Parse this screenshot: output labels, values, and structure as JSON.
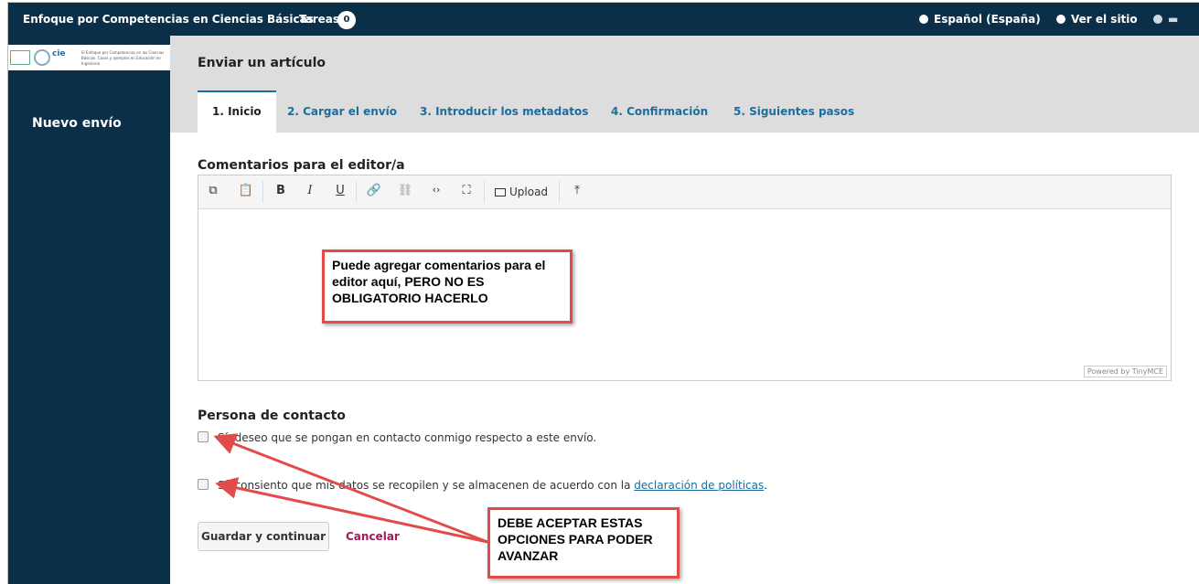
{
  "topbar": {
    "site_title": "Enfoque por Competencias en Ciencias Básicas",
    "tasks_label": "Tareas",
    "tasks_count": "0",
    "language": "Español (España)",
    "view_site": "Ver el sitio"
  },
  "sidebar": {
    "logo_text": "El Enfoque por Competencias en las Ciencias Básicas. Casos y ejemplos en Educación en Ingeniería",
    "new_submission": "Nuevo envío"
  },
  "header": {
    "title": "Enviar un artículo",
    "tabs": [
      {
        "label": "1. Inicio",
        "active": true
      },
      {
        "label": "2. Cargar el envío"
      },
      {
        "label": "3. Introducir los metadatos"
      },
      {
        "label": "4. Confirmación"
      },
      {
        "label": "5. Siguientes pasos"
      }
    ]
  },
  "comments": {
    "title": "Comentarios para el editor/a",
    "upload_label": "Upload",
    "powered_by": "Powered by TinyMCE"
  },
  "contact": {
    "title": "Persona de contacto",
    "option1": "Sí, deseo que se pongan en contacto conmigo respecto a este envío.",
    "option2_prefix": "Sí, consiento que mis datos se recopilen y se almacenen de acuerdo con la ",
    "option2_link": "declaración de políticas",
    "option2_suffix": "."
  },
  "actions": {
    "save": "Guardar y continuar",
    "cancel": "Cancelar"
  },
  "annotations": {
    "callout1": "Puede agregar comentarios para el editor aquí, PERO NO ES OBLIGATORIO HACERLO",
    "callout2": "DEBE ACEPTAR ESTAS OPCIONES PARA PODER AVANZAR"
  },
  "colors": {
    "nav_bg": "#0c2f49",
    "link": "#1a6ea0",
    "callout_border": "#e34b4b"
  }
}
